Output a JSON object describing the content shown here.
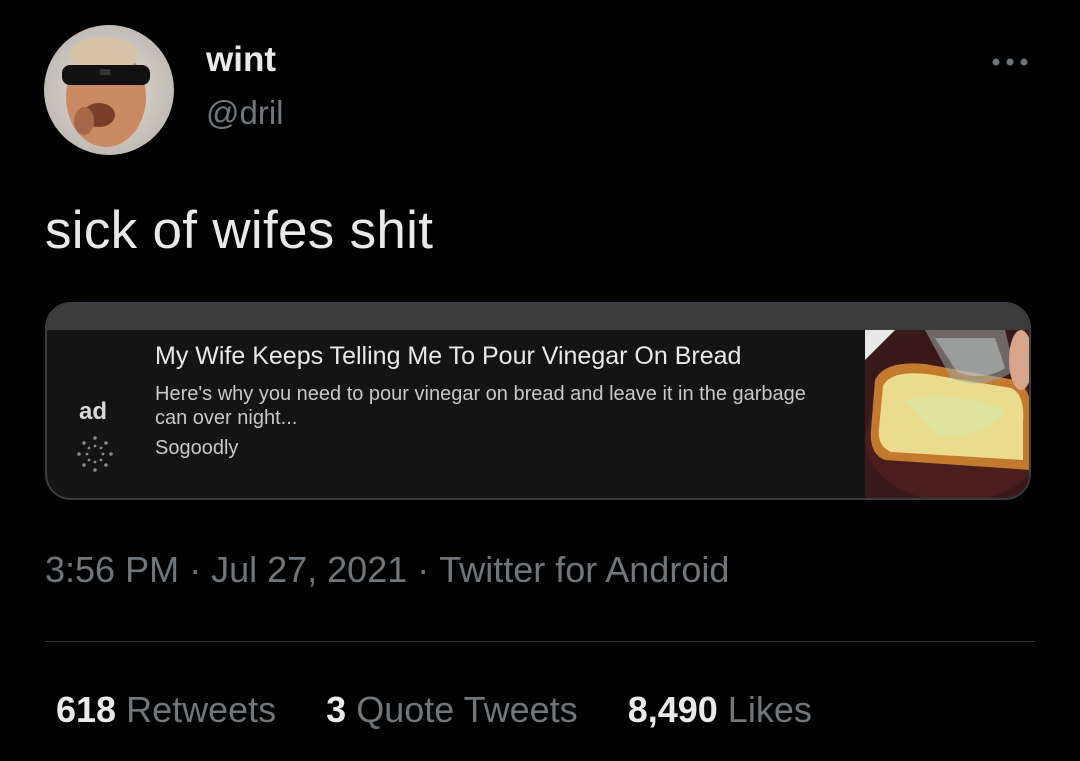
{
  "tweet": {
    "author": {
      "display_name": "wint",
      "handle": "@dril",
      "avatar_icon": "avatar-photo"
    },
    "text": "sick of wifes shit",
    "more_icon": "ellipsis-icon",
    "embed": {
      "ad_label": "ad",
      "title": "My Wife Keeps Telling Me To Pour Vinegar On Bread",
      "description": "Here's why you need to pour vinegar on bread and leave it in the garbage can over night...",
      "source": "Sogoodly",
      "thumbnail_icon": "bread-vinegar-image"
    },
    "meta": {
      "time": "3:56 PM",
      "separator": "·",
      "date": "Jul 27, 2021",
      "client": "Twitter for Android"
    },
    "stats": {
      "retweets_count": "618",
      "retweets_label": "Retweets",
      "quotes_count": "3",
      "quotes_label": "Quote Tweets",
      "likes_count": "8,490",
      "likes_label": "Likes"
    }
  },
  "colors": {
    "background": "#000000",
    "primary_text": "#e7e9ea",
    "secondary_text": "#71767b",
    "card_bg": "#141414",
    "card_border": "#3a3d41"
  }
}
